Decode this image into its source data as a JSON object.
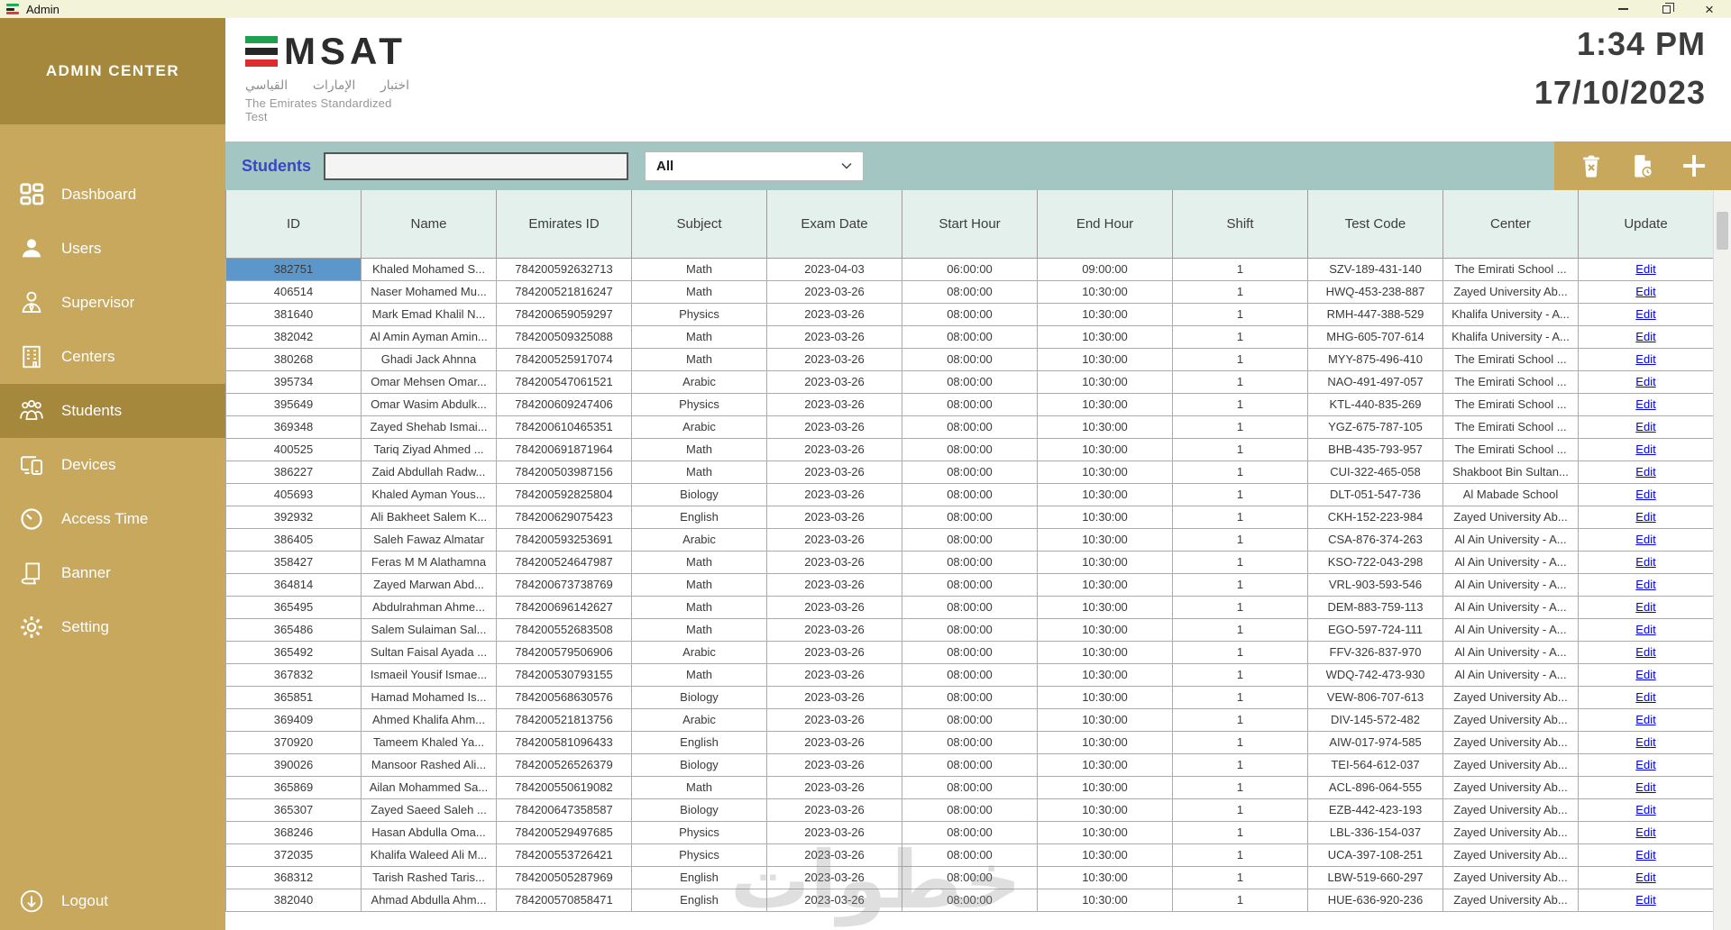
{
  "window": {
    "title": "Admin"
  },
  "icons": {
    "close_glyph": "×"
  },
  "sidebar": {
    "header": "ADMIN CENTER",
    "items": [
      {
        "label": "Dashboard",
        "active": false
      },
      {
        "label": "Users",
        "active": false
      },
      {
        "label": "Supervisor",
        "active": false
      },
      {
        "label": "Centers",
        "active": false
      },
      {
        "label": "Students",
        "active": true
      },
      {
        "label": "Devices",
        "active": false
      },
      {
        "label": "Access Time",
        "active": false
      },
      {
        "label": "Banner",
        "active": false
      },
      {
        "label": "Setting",
        "active": false
      }
    ],
    "logout": "Logout"
  },
  "header": {
    "logo_word": "MSAT",
    "logo_arabic": "اختبار الإمارات القياسي",
    "logo_tagline": "The Emirates Standardized Test",
    "time": "1:34 PM",
    "date": "17/10/2023"
  },
  "toolbar": {
    "title": "Students",
    "search_value": "",
    "filter_value": "All"
  },
  "table": {
    "columns": [
      "ID",
      "Name",
      "Emirates ID",
      "Subject",
      "Exam Date",
      "Start Hour",
      "End Hour",
      "Shift",
      "Test Code",
      "Center",
      "Update"
    ],
    "selected": {
      "row": 0,
      "col": 0
    },
    "rows": [
      [
        "382751",
        "Khaled Mohamed S...",
        "784200592632713",
        "Math",
        "2023-04-03",
        "06:00:00",
        "09:00:00",
        "1",
        "SZV-189-431-140",
        "The Emirati School ...",
        "Edit"
      ],
      [
        "406514",
        "Naser Mohamed Mu...",
        "784200521816247",
        "Math",
        "2023-03-26",
        "08:00:00",
        "10:30:00",
        "1",
        "HWQ-453-238-887",
        "Zayed University Ab...",
        "Edit"
      ],
      [
        "381640",
        "Mark Emad Khalil N...",
        "784200659059297",
        "Physics",
        "2023-03-26",
        "08:00:00",
        "10:30:00",
        "1",
        "RMH-447-388-529",
        "Khalifa University - A...",
        "Edit"
      ],
      [
        "382042",
        "Al Amin Ayman Amin...",
        "784200509325088",
        "Math",
        "2023-03-26",
        "08:00:00",
        "10:30:00",
        "1",
        "MHG-605-707-614",
        "Khalifa University - A...",
        "Edit"
      ],
      [
        "380268",
        "Ghadi Jack Ahnna",
        "784200525917074",
        "Math",
        "2023-03-26",
        "08:00:00",
        "10:30:00",
        "1",
        "MYY-875-496-410",
        "The Emirati School ...",
        "Edit"
      ],
      [
        "395734",
        "Omar Mehsen Omar...",
        "784200547061521",
        "Arabic",
        "2023-03-26",
        "08:00:00",
        "10:30:00",
        "1",
        "NAO-491-497-057",
        "The Emirati School ...",
        "Edit"
      ],
      [
        "395649",
        "Omar Wasim Abdulk...",
        "784200609247406",
        "Physics",
        "2023-03-26",
        "08:00:00",
        "10:30:00",
        "1",
        "KTL-440-835-269",
        "The Emirati School ...",
        "Edit"
      ],
      [
        "369348",
        "Zayed Shehab Ismai...",
        "784200610465351",
        "Arabic",
        "2023-03-26",
        "08:00:00",
        "10:30:00",
        "1",
        "YGZ-675-787-105",
        "The Emirati School ...",
        "Edit"
      ],
      [
        "400525",
        "Tariq Ziyad Ahmed ...",
        "784200691871964",
        "Math",
        "2023-03-26",
        "08:00:00",
        "10:30:00",
        "1",
        "BHB-435-793-957",
        "The Emirati School ...",
        "Edit"
      ],
      [
        "386227",
        "Zaid Abdullah Radw...",
        "784200503987156",
        "Math",
        "2023-03-26",
        "08:00:00",
        "10:30:00",
        "1",
        "CUI-322-465-058",
        "Shakboot Bin Sultan...",
        "Edit"
      ],
      [
        "405693",
        "Khaled Ayman Yous...",
        "784200592825804",
        "Biology",
        "2023-03-26",
        "08:00:00",
        "10:30:00",
        "1",
        "DLT-051-547-736",
        "Al Mabade School",
        "Edit"
      ],
      [
        "392932",
        "Ali Bakheet Salem K...",
        "784200629075423",
        "English",
        "2023-03-26",
        "08:00:00",
        "10:30:00",
        "1",
        "CKH-152-223-984",
        "Zayed University Ab...",
        "Edit"
      ],
      [
        "386405",
        "Saleh Fawaz Almatar",
        "784200593253691",
        "Arabic",
        "2023-03-26",
        "08:00:00",
        "10:30:00",
        "1",
        "CSA-876-374-263",
        "Al Ain University - A...",
        "Edit"
      ],
      [
        "358427",
        "Feras M M Alathamna",
        "784200524647987",
        "Math",
        "2023-03-26",
        "08:00:00",
        "10:30:00",
        "1",
        "KSO-722-043-298",
        "Al Ain University - A...",
        "Edit"
      ],
      [
        "364814",
        "Zayed Marwan Abd...",
        "784200673738769",
        "Math",
        "2023-03-26",
        "08:00:00",
        "10:30:00",
        "1",
        "VRL-903-593-546",
        "Al Ain University - A...",
        "Edit"
      ],
      [
        "365495",
        "Abdulrahman Ahme...",
        "784200696142627",
        "Math",
        "2023-03-26",
        "08:00:00",
        "10:30:00",
        "1",
        "DEM-883-759-113",
        "Al Ain University - A...",
        "Edit"
      ],
      [
        "365486",
        "Salem Sulaiman Sal...",
        "784200552683508",
        "Math",
        "2023-03-26",
        "08:00:00",
        "10:30:00",
        "1",
        "EGO-597-724-111",
        "Al Ain University - A...",
        "Edit"
      ],
      [
        "365492",
        "Sultan Faisal Ayada ...",
        "784200579506906",
        "Arabic",
        "2023-03-26",
        "08:00:00",
        "10:30:00",
        "1",
        "FFV-326-837-970",
        "Al Ain University - A...",
        "Edit"
      ],
      [
        "367832",
        "Ismaeil Yousif Ismae...",
        "784200530793155",
        "Math",
        "2023-03-26",
        "08:00:00",
        "10:30:00",
        "1",
        "WDQ-742-473-930",
        "Al Ain University - A...",
        "Edit"
      ],
      [
        "365851",
        "Hamad Mohamed Is...",
        "784200568630576",
        "Biology",
        "2023-03-26",
        "08:00:00",
        "10:30:00",
        "1",
        "VEW-806-707-613",
        "Zayed University Ab...",
        "Edit"
      ],
      [
        "369409",
        "Ahmed Khalifa Ahm...",
        "784200521813756",
        "Arabic",
        "2023-03-26",
        "08:00:00",
        "10:30:00",
        "1",
        "DIV-145-572-482",
        "Zayed University Ab...",
        "Edit"
      ],
      [
        "370920",
        "Tameem Khaled Ya...",
        "784200581096433",
        "English",
        "2023-03-26",
        "08:00:00",
        "10:30:00",
        "1",
        "AIW-017-974-585",
        "Zayed University Ab...",
        "Edit"
      ],
      [
        "390026",
        "Mansoor Rashed Ali...",
        "784200526526379",
        "Biology",
        "2023-03-26",
        "08:00:00",
        "10:30:00",
        "1",
        "TEI-564-612-037",
        "Zayed University Ab...",
        "Edit"
      ],
      [
        "365869",
        "Ailan Mohammed Sa...",
        "784200550619082",
        "Math",
        "2023-03-26",
        "08:00:00",
        "10:30:00",
        "1",
        "ACL-896-064-555",
        "Zayed University Ab...",
        "Edit"
      ],
      [
        "365307",
        "Zayed Saeed Saleh ...",
        "784200647358587",
        "Biology",
        "2023-03-26",
        "08:00:00",
        "10:30:00",
        "1",
        "EZB-442-423-193",
        "Zayed University Ab...",
        "Edit"
      ],
      [
        "368246",
        "Hasan Abdulla Oma...",
        "784200529497685",
        "Physics",
        "2023-03-26",
        "08:00:00",
        "10:30:00",
        "1",
        "LBL-336-154-037",
        "Zayed University Ab...",
        "Edit"
      ],
      [
        "372035",
        "Khalifa Waleed Ali M...",
        "784200553726421",
        "Physics",
        "2023-03-26",
        "08:00:00",
        "10:30:00",
        "1",
        "UCA-397-108-251",
        "Zayed University Ab...",
        "Edit"
      ],
      [
        "368312",
        "Tarish Rashed Taris...",
        "784200505287969",
        "English",
        "2023-03-26",
        "08:00:00",
        "10:30:00",
        "1",
        "LBW-519-660-297",
        "Zayed University Ab...",
        "Edit"
      ],
      [
        "382040",
        "Ahmad Abdulla Ahm...",
        "784200570858471",
        "English",
        "2023-03-26",
        "08:00:00",
        "10:30:00",
        "1",
        "HUE-636-920-236",
        "Zayed University Ab...",
        "Edit"
      ]
    ]
  },
  "watermark": "خطوات"
}
